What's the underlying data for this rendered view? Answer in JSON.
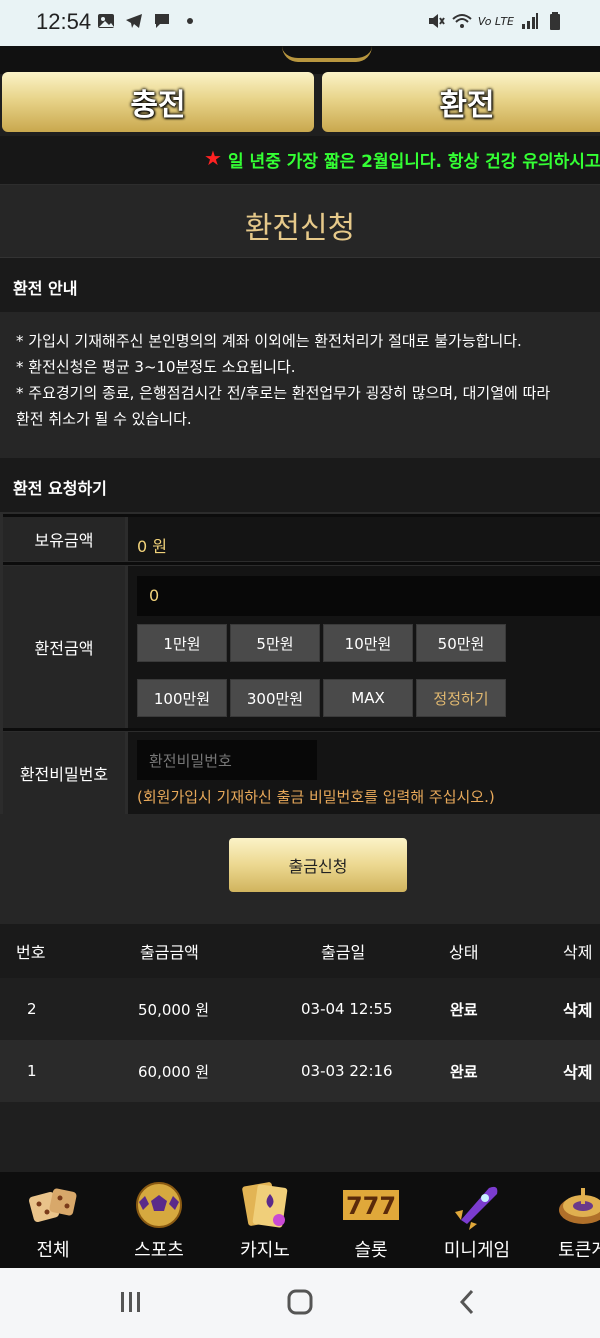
{
  "status_bar": {
    "time": "12:54",
    "left_icons": [
      "image-icon",
      "telegram-icon",
      "message-icon",
      "dot-icon"
    ],
    "right_icons": [
      "mute-icon",
      "wifi-icon",
      "volte-icon",
      "signal-icon",
      "battery-icon"
    ],
    "volte_label": "Vo LTE"
  },
  "top_buttons": {
    "charge": "충전",
    "exchange": "환전"
  },
  "marquee": {
    "star": "★",
    "text": "일 년중 가장 짧은 2월입니다. 항상 건강 유의하시고"
  },
  "page_title": "환전신청",
  "notice": {
    "heading": "환전 안내",
    "lines": [
      "* 가입시 기재해주신 본인명의의 계좌 이외에는 환전처리가 절대로 불가능합니다.",
      "* 환전신청은 평균 3~10분정도 소요됩니다.",
      "* 주요경기의 종료, 은행점검시간 전/후로는 환전업무가 굉장히 많으며, 대기열에 따라",
      "환전 취소가 될 수 있습니다."
    ]
  },
  "request": {
    "heading": "환전 요청하기",
    "balance_label": "보유금액",
    "balance_value": "0 원",
    "amount_label": "환전금액",
    "amount_value": "0",
    "amount_buttons": [
      "1만원",
      "5만원",
      "10만원",
      "50만원",
      "100만원",
      "300만원",
      "MAX",
      "정정하기"
    ],
    "password_label": "환전비밀번호",
    "password_placeholder": "환전비밀번호",
    "password_hint": "(회원가입시 기재하신 출금 비밀번호를 입력해 주십시오.)",
    "submit": "출금신청"
  },
  "history": {
    "columns": [
      "번호",
      "출금금액",
      "출금일",
      "상태",
      "삭제"
    ],
    "rows": [
      {
        "no": "2",
        "amount": "50,000 원",
        "date": "03-04 12:55",
        "status": "완료",
        "delete": "삭제"
      },
      {
        "no": "1",
        "amount": "60,000 원",
        "date": "03-03 22:16",
        "status": "완료",
        "delete": "삭제"
      }
    ]
  },
  "bottom_nav": [
    {
      "label": "전체",
      "icon": "dice-icon"
    },
    {
      "label": "스포츠",
      "icon": "soccer-ball-icon"
    },
    {
      "label": "카지노",
      "icon": "playing-card-icon"
    },
    {
      "label": "슬롯",
      "icon": "slot-777-icon"
    },
    {
      "label": "미니게임",
      "icon": "rocket-icon"
    },
    {
      "label": "토큰게",
      "icon": "roulette-icon"
    }
  ],
  "colors": {
    "gold_text": "#e6c98a",
    "marquee_green": "#34ff34",
    "star_red": "#ff2222",
    "hint_orange": "#e8a95a",
    "value_gold": "#f1d27a"
  }
}
